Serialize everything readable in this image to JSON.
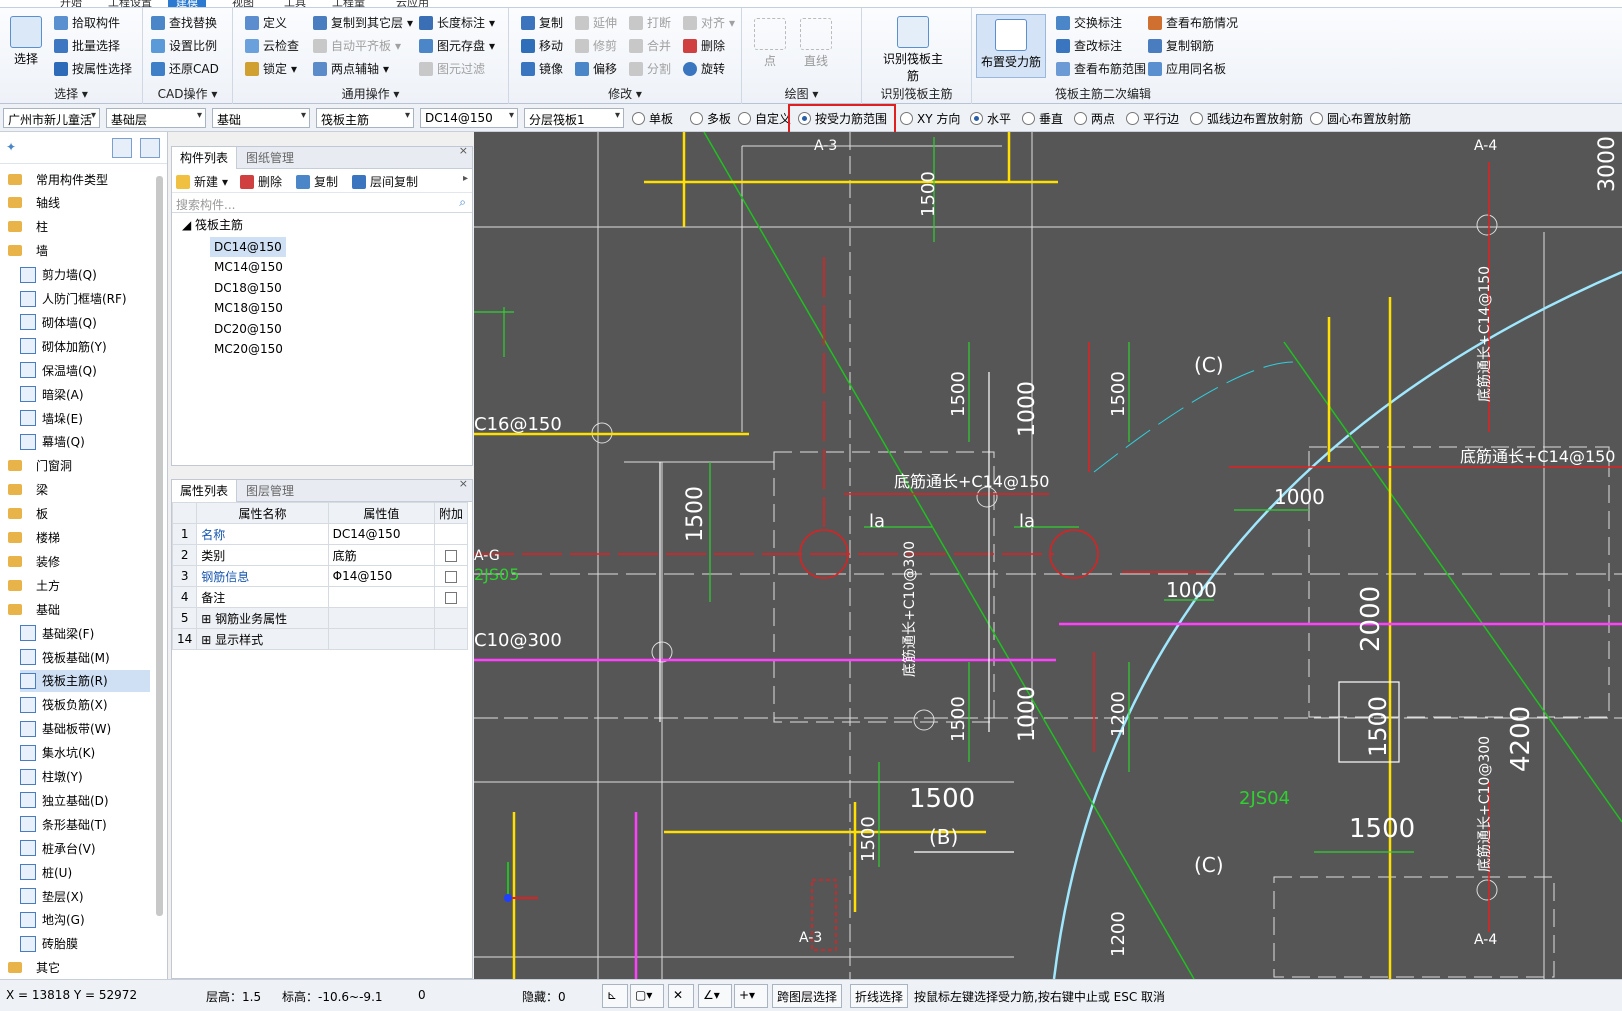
{
  "ribbon": {
    "tabs": [
      "开始",
      "工程设置",
      "建模",
      "视图",
      "工具",
      "工程量",
      "云应用"
    ],
    "select_group": {
      "label": "选择",
      "big": "选择",
      "items": [
        "拾取构件",
        "批量选择",
        "按属性选择"
      ]
    },
    "cad_group": {
      "label": "CAD操作",
      "items": [
        "查找替换",
        "设置比例",
        "还原CAD"
      ]
    },
    "common_group": {
      "label": "通用操作",
      "items": [
        "定义",
        "复制到其它层",
        "长度标注",
        "云检查",
        "自动平齐板",
        "图元存盘",
        "锁定",
        "两点辅轴",
        "图元过滤"
      ]
    },
    "modify_group": {
      "label": "修改",
      "items": [
        "复制",
        "延伸",
        "打断",
        "对齐",
        "移动",
        "修剪",
        "合并",
        "删除",
        "镜像",
        "偏移",
        "分割",
        "旋转"
      ]
    },
    "draw_group": {
      "label": "绘图",
      "items": [
        "点",
        "直线"
      ]
    },
    "identify_group": {
      "label": "识别筏板主筋",
      "big": "识别筏板主筋"
    },
    "edit_group": {
      "label": "筏板主筋二次编辑",
      "big": "布置受力筋",
      "items": [
        "交换标注",
        "查看布筋情况",
        "查改标注",
        "复制钢筋",
        "查看布筋范围",
        "应用同名板"
      ]
    }
  },
  "toolbar": {
    "selects": [
      "广州市新儿童活",
      "基础层",
      "基础",
      "筏板主筋",
      "DC14@150",
      "分层筏板1"
    ],
    "radios": [
      {
        "label": "单板",
        "on": false
      },
      {
        "label": "多板",
        "on": false
      },
      {
        "label": "自定义",
        "on": false
      },
      {
        "label": "按受力筋范围",
        "on": true
      },
      {
        "label": "XY 方向",
        "on": false
      },
      {
        "label": "水平",
        "on": true
      },
      {
        "label": "垂直",
        "on": false
      },
      {
        "label": "两点",
        "on": false
      },
      {
        "label": "平行边",
        "on": false
      },
      {
        "label": "弧线边布置放射筋",
        "on": false
      },
      {
        "label": "圆心布置放射筋",
        "on": false
      }
    ]
  },
  "tree": {
    "items": [
      {
        "label": "常用构件类型",
        "type": "folder"
      },
      {
        "label": "轴线",
        "type": "folder"
      },
      {
        "label": "柱",
        "type": "folder"
      },
      {
        "label": "墙",
        "type": "folder"
      },
      {
        "label": "剪力墙(Q)",
        "type": "sub"
      },
      {
        "label": "人防门框墙(RF)",
        "type": "sub"
      },
      {
        "label": "砌体墙(Q)",
        "type": "sub"
      },
      {
        "label": "砌体加筋(Y)",
        "type": "sub"
      },
      {
        "label": "保温墙(Q)",
        "type": "sub"
      },
      {
        "label": "暗梁(A)",
        "type": "sub"
      },
      {
        "label": "墙垛(E)",
        "type": "sub"
      },
      {
        "label": "幕墙(Q)",
        "type": "sub"
      },
      {
        "label": "门窗洞",
        "type": "folder"
      },
      {
        "label": "梁",
        "type": "folder"
      },
      {
        "label": "板",
        "type": "folder"
      },
      {
        "label": "楼梯",
        "type": "folder"
      },
      {
        "label": "装修",
        "type": "folder"
      },
      {
        "label": "土方",
        "type": "folder"
      },
      {
        "label": "基础",
        "type": "folder"
      },
      {
        "label": "基础梁(F)",
        "type": "sub"
      },
      {
        "label": "筏板基础(M)",
        "type": "sub"
      },
      {
        "label": "筏板主筋(R)",
        "type": "sub",
        "selected": true
      },
      {
        "label": "筏板负筋(X)",
        "type": "sub"
      },
      {
        "label": "基础板带(W)",
        "type": "sub"
      },
      {
        "label": "集水坑(K)",
        "type": "sub"
      },
      {
        "label": "柱墩(Y)",
        "type": "sub"
      },
      {
        "label": "独立基础(D)",
        "type": "sub"
      },
      {
        "label": "条形基础(T)",
        "type": "sub"
      },
      {
        "label": "桩承台(V)",
        "type": "sub"
      },
      {
        "label": "桩(U)",
        "type": "sub"
      },
      {
        "label": "垫层(X)",
        "type": "sub"
      },
      {
        "label": "地沟(G)",
        "type": "sub"
      },
      {
        "label": "砖胎膜",
        "type": "sub"
      },
      {
        "label": "其它",
        "type": "folder"
      }
    ]
  },
  "component_panel": {
    "tabs": [
      "构件列表",
      "图纸管理"
    ],
    "actions": [
      "新建",
      "删除",
      "复制",
      "层间复制"
    ],
    "search_placeholder": "搜索构件...",
    "group": "筏板主筋",
    "items": [
      "DC14@150",
      "MC14@150",
      "DC18@150",
      "MC18@150",
      "DC20@150",
      "MC20@150"
    ],
    "selected": "DC14@150"
  },
  "property_panel": {
    "tabs": [
      "属性列表",
      "图层管理"
    ],
    "headers": [
      "属性名称",
      "属性值",
      "附加"
    ],
    "rows": [
      {
        "no": "1",
        "name": "名称",
        "value": "DC14@150",
        "blue": true,
        "check": false
      },
      {
        "no": "2",
        "name": "类别",
        "value": "底筋",
        "blue": false,
        "check": true
      },
      {
        "no": "3",
        "name": "钢筋信息",
        "value": "Φ14@150",
        "blue": true,
        "check": true
      },
      {
        "no": "4",
        "name": "备注",
        "value": "",
        "blue": false,
        "check": true
      },
      {
        "no": "5",
        "name": "钢筋业务属性",
        "value": "",
        "blue": false,
        "check": false,
        "expand": true
      },
      {
        "no": "14",
        "name": "显示样式",
        "value": "",
        "blue": false,
        "check": false,
        "expand": true
      }
    ]
  },
  "canvas": {
    "labels": [
      "A-3",
      "A-4",
      "C16@150",
      "C10@300",
      "A-G",
      "2JS05",
      "2JS04",
      "(C)",
      "(B)",
      "1500",
      "1000",
      "2000",
      "4200",
      "1200",
      "la",
      "底筋通长+C14@150",
      "底筋通长+C10@300",
      "3000"
    ]
  },
  "status": {
    "coords": "X = 13818 Y = 52972",
    "floor_height": "层高：1.5",
    "elevation": "标高：-10.6~-9.1",
    "zero": "0",
    "hidden": "隐藏：0",
    "btn_layer": "跨图层选择",
    "btn_poly": "折线选择",
    "hint": "按鼠标左键选择受力筋,按右键中止或 ESC 取消"
  }
}
